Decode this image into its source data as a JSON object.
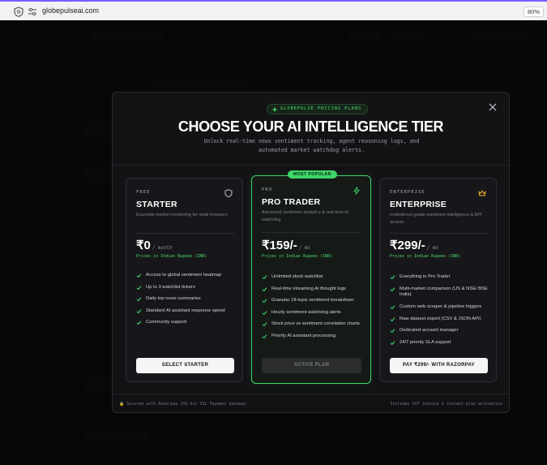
{
  "browser": {
    "url": "globepulseai.com",
    "zoom": "80%"
  },
  "modal": {
    "badge": "GLOBEPULSE PRICING PLANS",
    "title": "CHOOSE YOUR AI INTELLIGENCE TIER",
    "subtitle": "Unlock real-time news sentiment tracking, agent reasoning logs, and automated market watchdog alerts.",
    "footer_left": "Secured with Razorpay 256-bit SSL Payment Gateway",
    "footer_right": "Includes GST invoice & instant plan activation"
  },
  "plans": [
    {
      "tier": "FREE",
      "name": "STARTER",
      "description": "Essential market monitoring for retail investors",
      "price": "₹0",
      "period": "/ month",
      "currency_note": "Prices in Indian Rupees (INR)",
      "icon": "shield-icon",
      "features": [
        "Access to global sentiment heatmap",
        "Up to 3 watchlist tickers",
        "Daily top news summaries",
        "Standard AI assistant response speed",
        "Community support"
      ],
      "cta": "SELECT STARTER"
    },
    {
      "tier": "PRO",
      "name": "PRO TRADER",
      "description": "Advanced sentiment analytics & real-time AI watchdog",
      "price": "₹159/-",
      "period": "/ mo",
      "currency_note": "Prices in Indian Rupees (INR)",
      "icon": "lightning-icon",
      "badge": "MOST POPULAR",
      "features": [
        "Unlimited stock watchlist",
        "Real-time streaming AI thought logs",
        "Granular 18-topic sentiment breakdown",
        "Hourly sentiment watchdog alerts",
        "Stock price vs sentiment correlation charts",
        "Priority AI assistant processing"
      ],
      "cta": "ACTIVE PLAN"
    },
    {
      "tier": "ENTERPRISE",
      "name": "ENTERPRISE",
      "description": "Institutional-grade sentiment intelligence & API access",
      "price": "₹299/-",
      "period": "/ mo",
      "currency_note": "Prices in Indian Rupees (INR)",
      "icon": "crown-icon",
      "features": [
        "Everything in Pro Trader",
        "Multi-market comparison (US & NSE/ BSE India)",
        "Custom web scraper & pipeline triggers",
        "Raw dataset export (CSV & JSON API)",
        "Dedicated account manager",
        "24/7 priority SLA support"
      ],
      "cta": "PAY ₹299/- WITH RAZORPAY"
    }
  ],
  "colors": {
    "accent": "#3ed56a",
    "background": "#0b0b0d",
    "card": "#17171b"
  }
}
